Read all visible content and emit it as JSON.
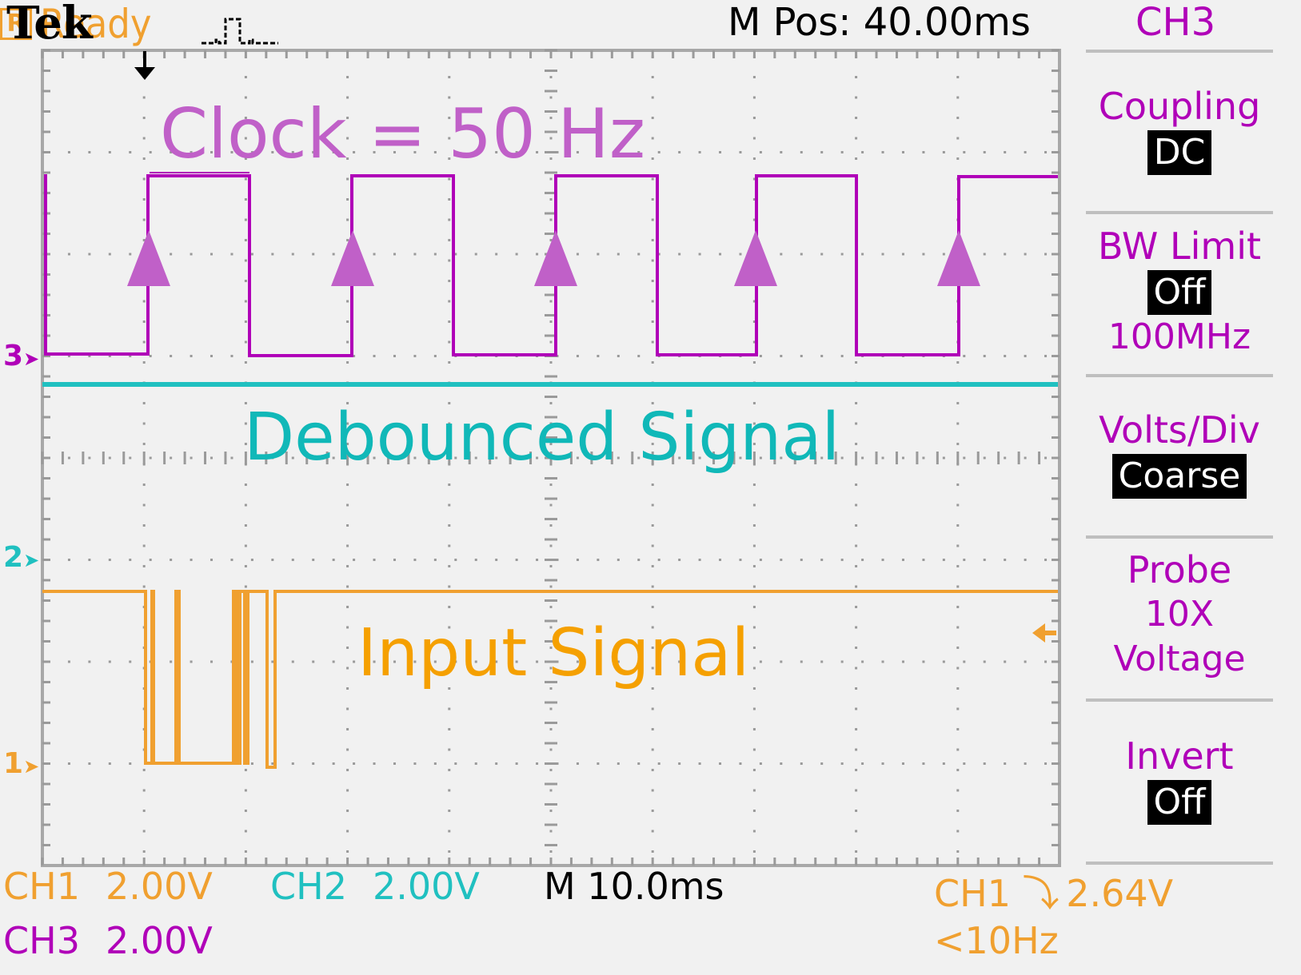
{
  "header": {
    "brand": "Tek",
    "trigger_icon": "pulse-icon",
    "status_glyph": "R",
    "status": "Ready",
    "m_pos": "M Pos: 40.00ms",
    "menu_channel": "CH3"
  },
  "menu": {
    "coupling": {
      "label": "Coupling",
      "value": "DC"
    },
    "bw_limit": {
      "label": "BW Limit",
      "value": "Off",
      "sub": "100MHz"
    },
    "volts_div": {
      "label": "Volts/Div",
      "value": "Coarse"
    },
    "probe": {
      "label": "Probe",
      "line2": "10X",
      "line3": "Voltage"
    },
    "invert": {
      "label": "Invert",
      "value": "Off"
    }
  },
  "annotations": {
    "clock": "Clock = 50 Hz",
    "debounced": "Debounced Signal",
    "input": "Input Signal"
  },
  "channel_markers": {
    "ch3": "3",
    "ch2": "2",
    "ch1": "1"
  },
  "footer": {
    "ch1_label": "CH1",
    "ch1_scale": "2.00V",
    "ch2_label": "CH2",
    "ch2_scale": "2.00V",
    "ch3_label": "CH3",
    "ch3_scale": "2.00V",
    "timebase": "M 10.0ms",
    "trigger_source": "CH1",
    "trigger_level": "2.64V",
    "trigger_freq": "<10Hz"
  },
  "colors": {
    "ch1": "#f0a030",
    "ch2": "#20c0c0",
    "ch3": "#b000b8",
    "annotation_purple": "#c060c8",
    "annotation_teal": "#10b8b8",
    "annotation_orange": "#f5a000",
    "grid": "#9a9a9a"
  }
}
